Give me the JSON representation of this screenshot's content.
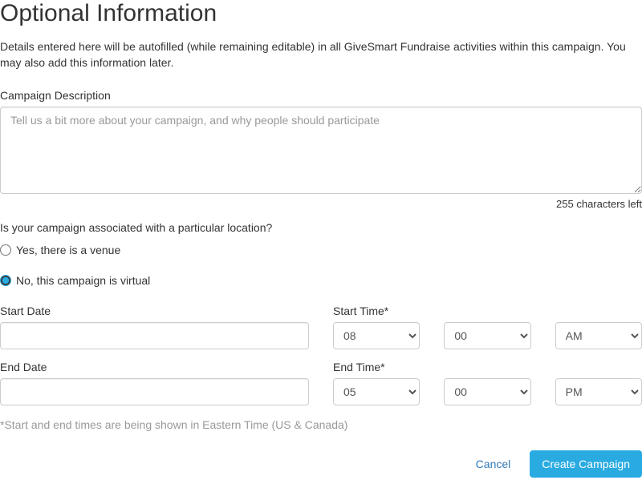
{
  "heading": "Optional Information",
  "intro": "Details entered here will be autofilled (while remaining editable) in all GiveSmart Fundraise activities within this campaign. You may also add this information later.",
  "description": {
    "label": "Campaign Description",
    "placeholder": "Tell us a bit more about your campaign, and why people should participate",
    "char_counter": "255 characters left"
  },
  "location": {
    "question": "Is your campaign associated with a particular location?",
    "yes_label": "Yes, there is a venue",
    "no_label": "No, this campaign is virtual",
    "selected": "no"
  },
  "dates": {
    "start_date_label": "Start Date",
    "end_date_label": "End Date",
    "start_time_label": "Start Time*",
    "end_time_label": "End Time*",
    "start_hour": "08",
    "start_minute": "00",
    "start_ampm": "AM",
    "end_hour": "05",
    "end_minute": "00",
    "end_ampm": "PM",
    "tz_note": "*Start and end times are being shown in Eastern Time (US & Canada)"
  },
  "actions": {
    "cancel": "Cancel",
    "create": "Create Campaign"
  }
}
